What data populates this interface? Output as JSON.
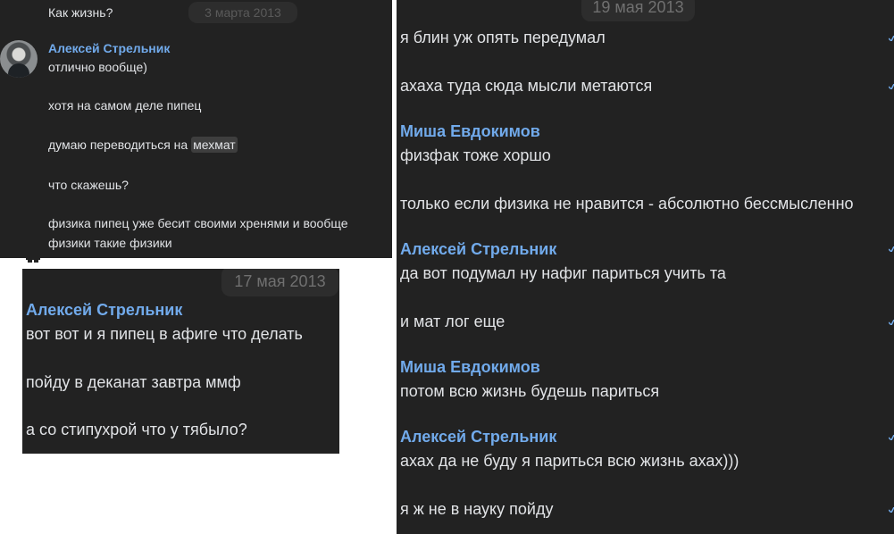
{
  "panel1": {
    "prev_message": "Как жизнь?",
    "date": "3 марта 2013",
    "author": "Алексей Стрельник",
    "messages": [
      "отлично вообще)",
      "хотя на самом деле пипец",
      "думаю переводиться на",
      "что скажешь?",
      "физика пипец уже бесит своими хренями и вообще",
      "физики такие физики"
    ],
    "highlight_word": "мехмат"
  },
  "panel2": {
    "date": "17 мая 2013",
    "author": "Алексей Стрельник",
    "messages": [
      "вот вот и я пипец в афиге что делать",
      "пойду в деканат завтра ммф",
      "а со стипухрой что у тябыло?"
    ]
  },
  "panel3": {
    "date": "19 мая 2013",
    "messages": [
      "я блин уж опять передумал",
      "ахаха туда сюда мысли метаются"
    ],
    "group2": {
      "author": "Миша Евдокимов",
      "messages": [
        "физфак тоже хоршо",
        "только если физика не нравится - абсолютно бессмысленно"
      ]
    },
    "group3": {
      "author": "Алексей Стрельник",
      "messages": [
        "да вот подумал ну нафиг париться учить та",
        "и мат лог еще"
      ]
    },
    "group4": {
      "author": "Миша Евдокимов",
      "messages": [
        "потом всю жизнь будешь париться"
      ]
    },
    "group5": {
      "author": "Алексей Стрельник",
      "messages": [
        "ахах да не буду я париться всю жизнь ахах)))",
        "я ж не в науку пойду"
      ]
    }
  }
}
